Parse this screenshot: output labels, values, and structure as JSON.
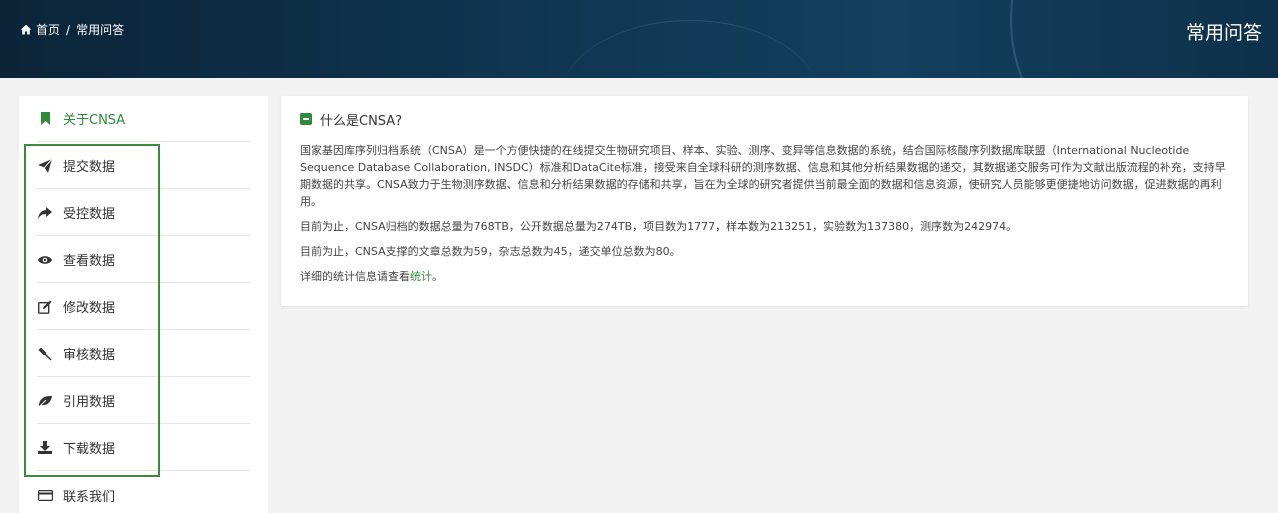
{
  "header": {
    "breadcrumb": {
      "home": "首页",
      "separator": "/",
      "current": "常用问答"
    },
    "title": "常用问答"
  },
  "sidebar": {
    "items": [
      {
        "label": "关于CNSA",
        "icon": "bookmark-icon",
        "active": true
      },
      {
        "label": "提交数据",
        "icon": "paper-plane-icon"
      },
      {
        "label": "受控数据",
        "icon": "share-arrow-icon"
      },
      {
        "label": "查看数据",
        "icon": "eye-icon"
      },
      {
        "label": "修改数据",
        "icon": "edit-icon"
      },
      {
        "label": "审核数据",
        "icon": "gavel-icon"
      },
      {
        "label": "引用数据",
        "icon": "leaf-icon"
      },
      {
        "label": "下载数据",
        "icon": "download-icon"
      },
      {
        "label": "联系我们",
        "icon": "credit-card-icon"
      }
    ]
  },
  "content": {
    "heading": "什么是CNSA?",
    "para1": "国家基因库序列归档系统（CNSA）是一个方便快捷的在线提交生物研究项目、样本、实验、测序、变异等信息数据的系统，结合国际核酸序列数据库联盟（International Nucleotide Sequence Database Collaboration, INSDC）标准和DataCite标准，接受来自全球科研的测序数据、信息和其他分析结果数据的递交，其数据递交服务可作为文献出版流程的补充，支持早期数据的共享。CNSA致力于生物测序数据、信息和分析结果数据的存储和共享，旨在为全球的研究者提供当前最全面的数据和信息资源，使研究人员能够更便捷地访问数据，促进数据的再利用。",
    "para2": "目前为止，CNSA归档的数据总量为768TB，公开数据总量为274TB，项目数为1777，样本数为213251，实验数为137380，测序数为242974。",
    "para3": "目前为止，CNSA支撑的文章总数为59，杂志总数为45，递交单位总数为80。",
    "para4_prefix": "详细的统计信息请查看",
    "para4_link": "统计",
    "para4_suffix": "。"
  },
  "colors": {
    "accent": "#2f8a3c",
    "banner": "#0f3550",
    "highlight_box": "#3d8a3a"
  }
}
